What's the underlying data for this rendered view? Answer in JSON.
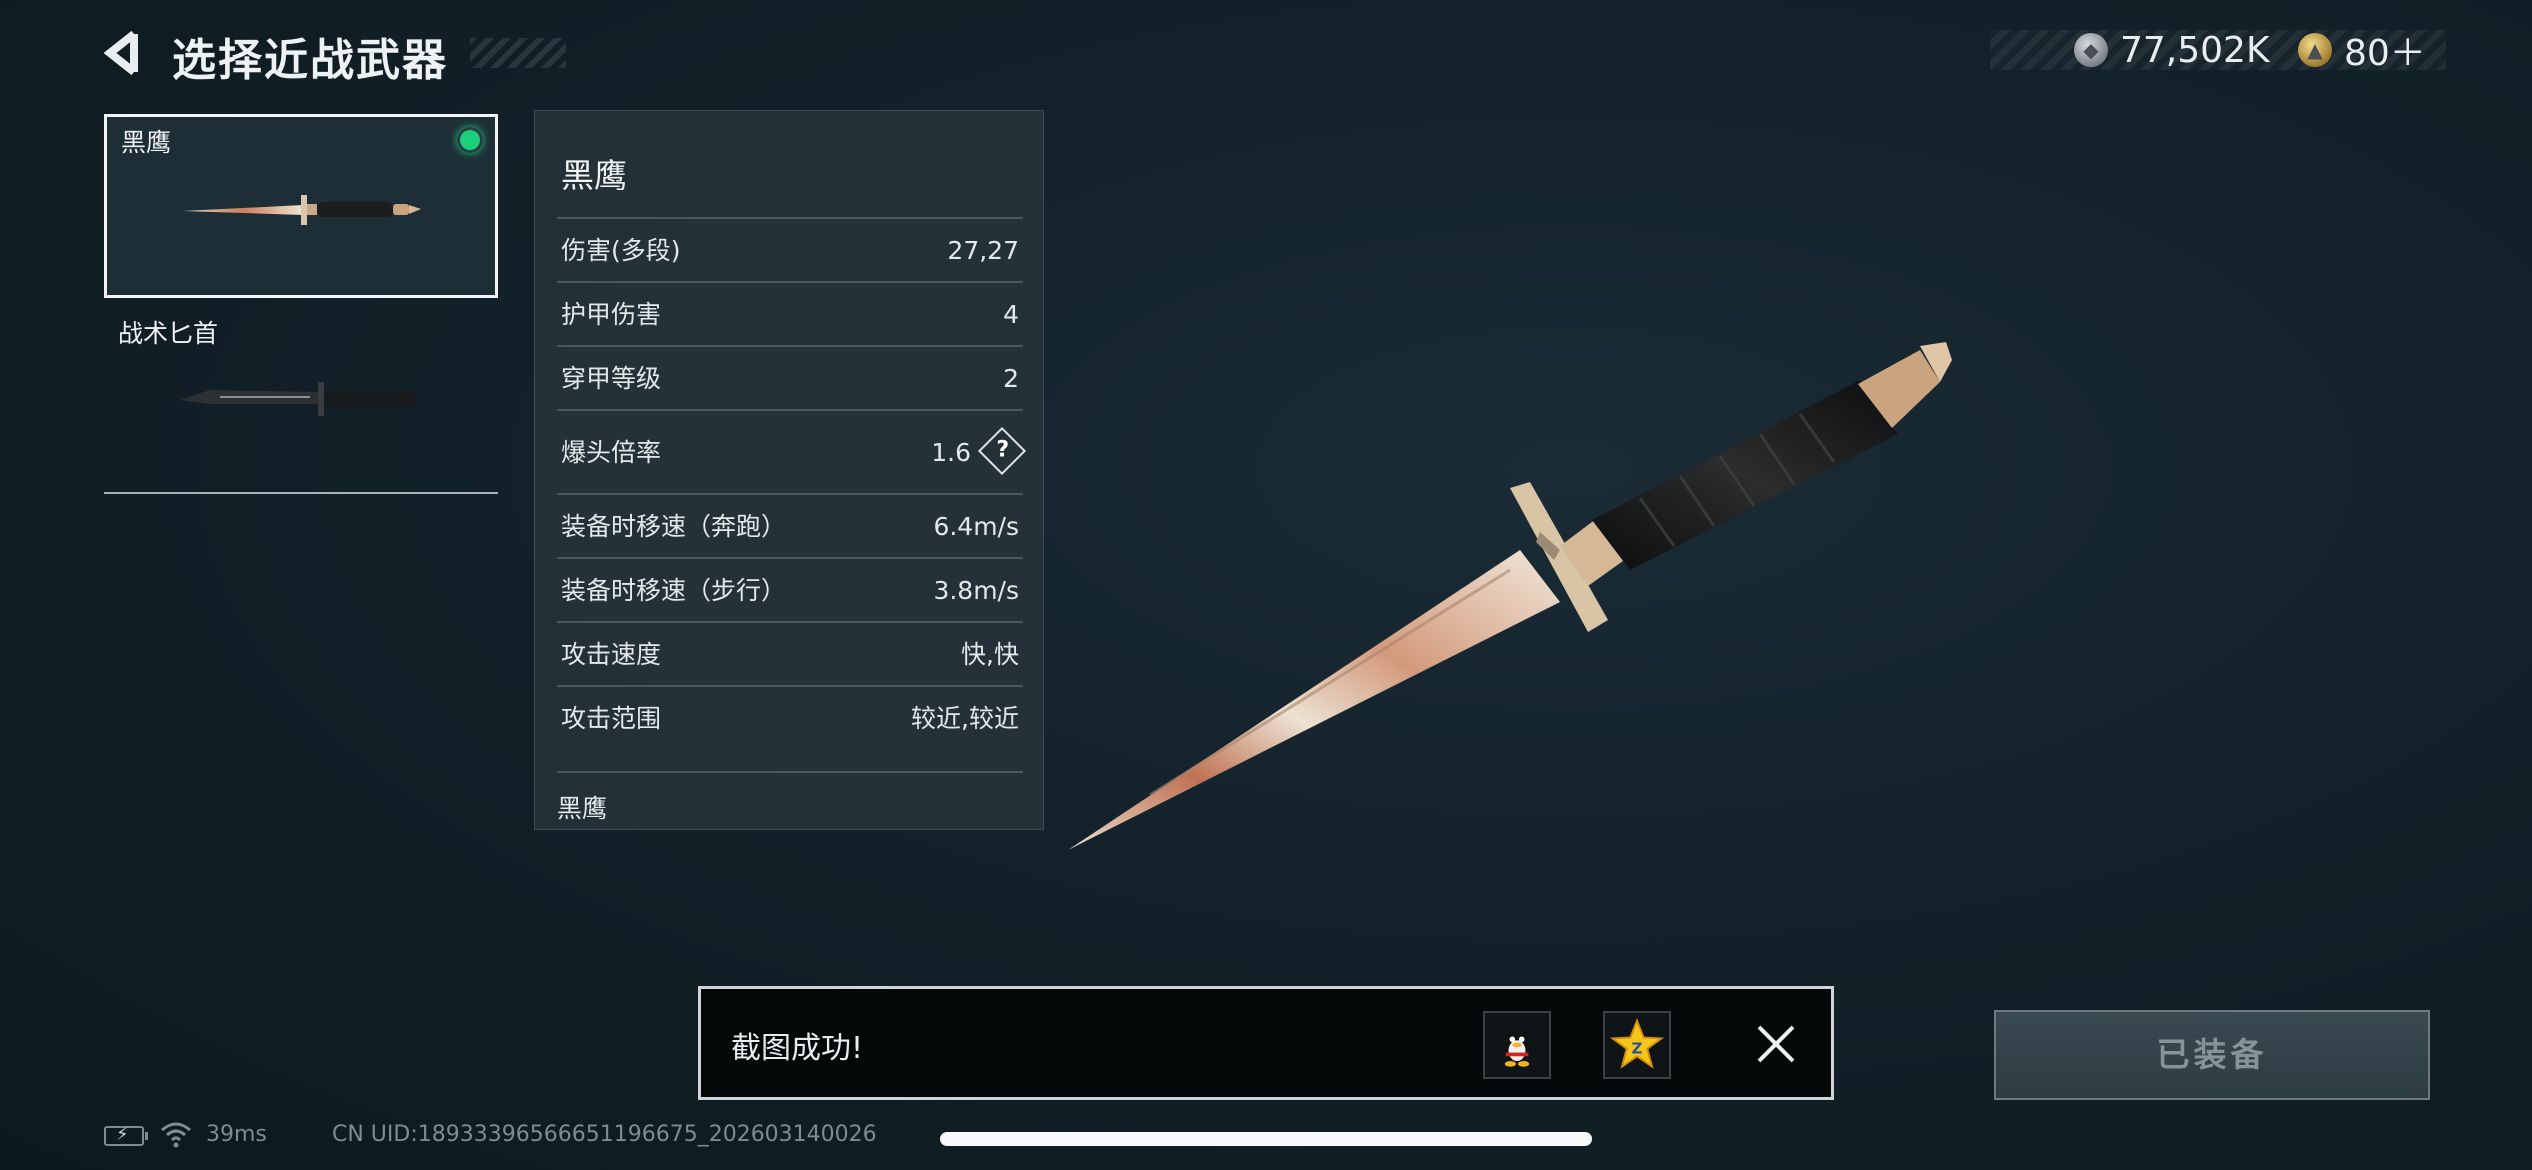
{
  "header": {
    "title": "选择近战武器",
    "back_icon": "back-arrow-icon"
  },
  "currency": {
    "silver_value": "77,502K",
    "silver_icon": "silver-coin-icon",
    "gold_value": "80＋",
    "gold_icon": "gold-coin-icon"
  },
  "weapons": [
    {
      "name": "黑鹰",
      "selected": true,
      "equipped": true
    },
    {
      "name": "战术匕首",
      "selected": false,
      "equipped": false
    }
  ],
  "stats": {
    "title": "黑鹰",
    "rows": [
      {
        "label": "伤害(多段)",
        "value": "27,27"
      },
      {
        "label": "护甲伤害",
        "value": "4"
      },
      {
        "label": "穿甲等级",
        "value": "2"
      },
      {
        "label": "爆头倍率",
        "value": "1.6",
        "help": "?"
      },
      {
        "label": "装备时移速（奔跑）",
        "value": "6.4m/s"
      },
      {
        "label": "装备时移速（步行）",
        "value": "3.8m/s"
      },
      {
        "label": "攻击速度",
        "value": "快,快"
      },
      {
        "label": "攻击范围",
        "value": "较近,较近"
      }
    ],
    "footer": "黑鹰"
  },
  "toast": {
    "message": "截图成功!",
    "share_icons": [
      "qq-penguin-icon",
      "qzone-star-icon"
    ],
    "close_icon": "close-icon"
  },
  "equip_button": {
    "label": "已装备",
    "state": "disabled"
  },
  "status_bar": {
    "ping": "39ms",
    "uid": "CN UID:18933396566651196675_202603140026"
  },
  "colors": {
    "accent_green": "#1ccf7b",
    "background": "#13212a",
    "panel": "#28343c"
  }
}
